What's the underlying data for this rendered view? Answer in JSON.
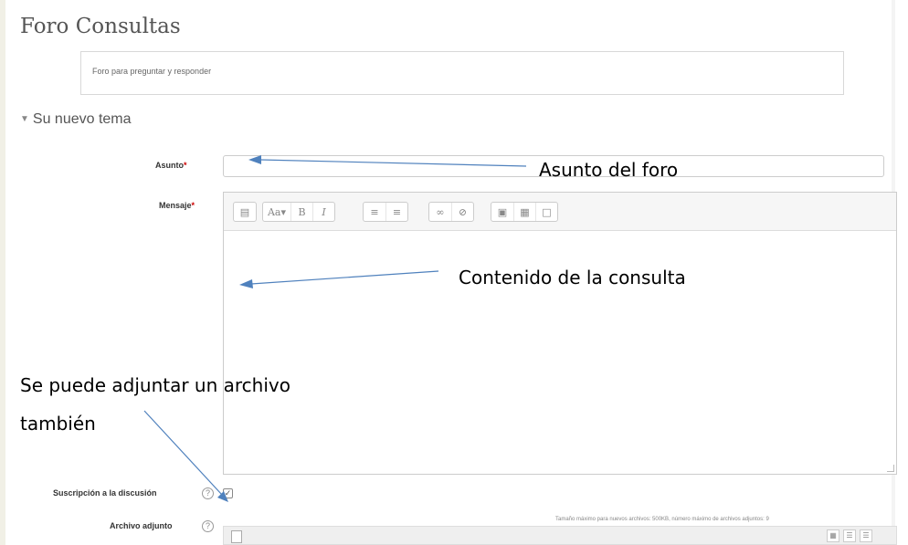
{
  "forum": {
    "title": "Foro Consultas",
    "description": "Foro para preguntar y responder"
  },
  "section": {
    "title": "Su nuevo tema"
  },
  "form": {
    "subject_label": "Asunto",
    "message_label": "Mensaje",
    "required_mark": "*",
    "subscription_label": "Suscripción a la discusión",
    "attachment_label": "Archivo adjunto",
    "attachment_info": "Tamaño máximo para nuevos archivos: 500KB, número máximo de archivos adjuntos: 9",
    "subject_value": "",
    "subscription_checked": true
  },
  "toolbar_icons": [
    [
      "collapse-icon"
    ],
    [
      "font-style-icon",
      "bold-icon",
      "italic-icon"
    ],
    [
      "unordered-list-icon",
      "ordered-list-icon"
    ],
    [
      "link-icon",
      "unlink-icon"
    ],
    [
      "image-icon",
      "media-icon",
      "file-manager-icon"
    ]
  ],
  "annotations": {
    "subject": "Asunto del foro",
    "content": "Contenido de la consulta",
    "attachment_line1": "Se puede adjuntar un archivo",
    "attachment_line2": "también"
  },
  "colors": {
    "arrow": "#4f81bd"
  }
}
